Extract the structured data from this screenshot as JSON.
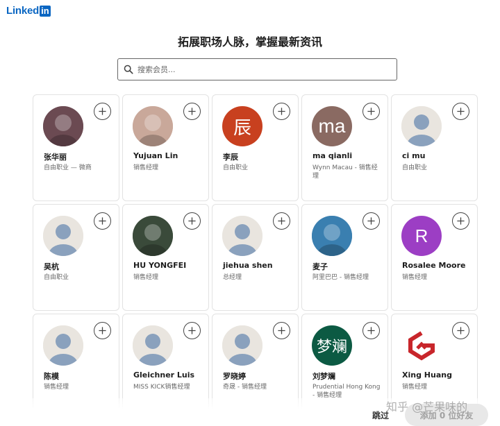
{
  "brand": {
    "logo_text": "Linked",
    "logo_box": "in",
    "color": "#0a66c2"
  },
  "headline": "拓展职场人脉，掌握最新资讯",
  "search": {
    "placeholder": "搜索会员..."
  },
  "cards": [
    {
      "name": "张华丽",
      "title": "自由职业 — 微商",
      "avatar": "photo",
      "avatar_color": "#6b4a52"
    },
    {
      "name": "Yujuan Lin",
      "title": "销售经理",
      "avatar": "photo",
      "avatar_color": "#c9a89a"
    },
    {
      "name": "李辰",
      "title": "自由职业",
      "avatar": "letter",
      "letter": "辰",
      "avatar_color": "#c8401f"
    },
    {
      "name": "ma qianli",
      "title": "Wynn Macau - 销售经理",
      "avatar": "letter",
      "letter": "ma",
      "avatar_color": "#8a6a62"
    },
    {
      "name": "ci mu",
      "title": "自由职业",
      "avatar": "placeholder"
    },
    {
      "name": "吴杭",
      "title": "自由职业",
      "avatar": "placeholder"
    },
    {
      "name": "HU YONGFEI",
      "title": "销售经理",
      "avatar": "photo",
      "avatar_color": "#3a4a3a"
    },
    {
      "name": "jiehua shen",
      "title": "总经理",
      "avatar": "placeholder"
    },
    {
      "name": "麦子",
      "title": "阿里巴巴 - 销售经理",
      "avatar": "photo",
      "avatar_color": "#3a7fb0"
    },
    {
      "name": "Rosalee Moore",
      "title": "销售经理",
      "avatar": "letter",
      "letter": "R",
      "avatar_color": "#9c3ec4"
    },
    {
      "name": "陈模",
      "title": "销售经理",
      "avatar": "placeholder"
    },
    {
      "name": "Gleichner Luis",
      "title": "MISS KICK销售经理",
      "avatar": "placeholder"
    },
    {
      "name": "罗晓婷",
      "title": "奇晟 - 销售经理",
      "avatar": "placeholder"
    },
    {
      "name": "刘梦斓",
      "title": "Prudential Hong Kong - 销售经理",
      "avatar": "letter",
      "letter": "梦斓",
      "avatar_color": "#0c5a43"
    },
    {
      "name": "Xing Huang",
      "title": "销售经理",
      "avatar": "logo",
      "avatar_color": "#c8262b"
    }
  ],
  "footer": {
    "skip": "跳过",
    "add": "添加 0 位好友"
  },
  "watermark": "知乎 @芒果味的"
}
